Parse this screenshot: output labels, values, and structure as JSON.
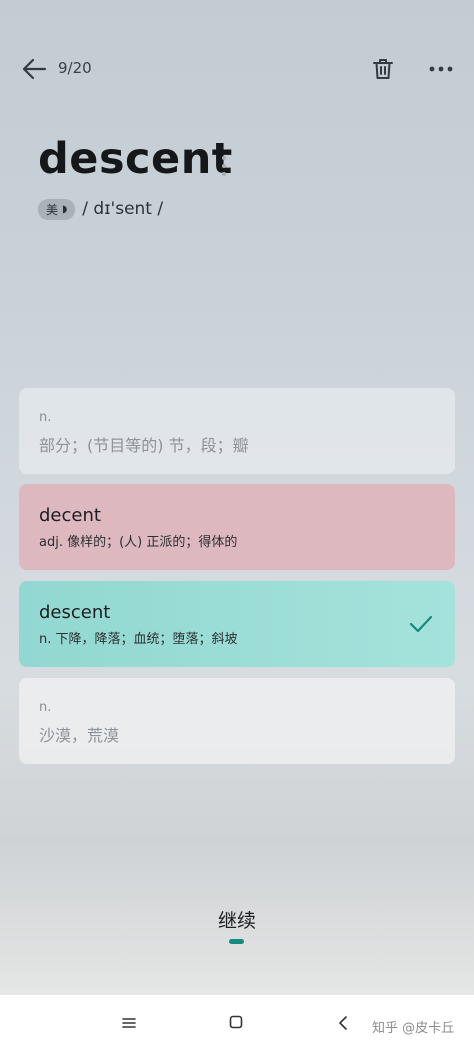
{
  "header": {
    "progress": "9/20",
    "icons": [
      "back-arrow-icon",
      "trash-icon",
      "more-icon"
    ]
  },
  "word": {
    "text": "descent",
    "accent": "美",
    "phonetic": "/ dɪ'sent /"
  },
  "options": [
    {
      "pos": "n.",
      "definition": "部分；(节目等的) 节，段；瓣",
      "state": "unselected"
    },
    {
      "word": "decent",
      "definition": "adj. 像样的；(人) 正派的；得体的",
      "state": "wrong"
    },
    {
      "word": "descent",
      "definition": "n. 下降，降落；血统；堕落；斜坡",
      "state": "correct"
    },
    {
      "pos": "n.",
      "definition": "沙漠，荒漠",
      "state": "unselected"
    }
  ],
  "continue_label": "继续",
  "watermark": "知乎 @皮卡丘",
  "colors": {
    "accent": "#158a80",
    "wrong": "#deb8bf",
    "correct": "#9ddcd6"
  }
}
